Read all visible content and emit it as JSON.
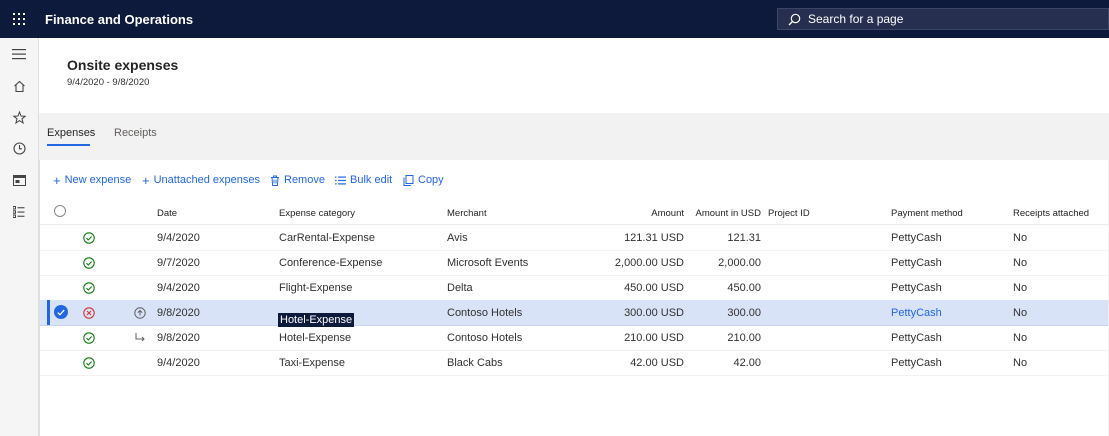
{
  "app": {
    "title": "Finance and Operations"
  },
  "search": {
    "placeholder": "Search for a page"
  },
  "nav": {
    "items": [
      "hamburger-icon",
      "home-icon",
      "star-icon",
      "clock-icon",
      "workspace-icon",
      "list-icon"
    ]
  },
  "page": {
    "title": "Onsite expenses",
    "date_range": "9/4/2020 - 9/8/2020"
  },
  "tabs": [
    {
      "label": "Expenses"
    },
    {
      "label": "Receipts"
    }
  ],
  "actions": [
    {
      "label": "New expense",
      "icon": "plus-icon"
    },
    {
      "label": "Unattached expenses",
      "icon": "plus-icon"
    },
    {
      "label": "Remove",
      "icon": "trash-icon"
    },
    {
      "label": "Bulk edit",
      "icon": "list-icon"
    },
    {
      "label": "Copy",
      "icon": "copy-icon"
    }
  ],
  "grid": {
    "columns": {
      "date": "Date",
      "category": "Expense category",
      "merchant": "Merchant",
      "amount": "Amount",
      "amount_usd": "Amount in USD",
      "project": "Project ID",
      "payment": "Payment method",
      "receipts": "Receipts attached"
    },
    "rows": [
      {
        "status": "ok",
        "sub": "",
        "date": "9/4/2020",
        "category": "CarRental-Expense",
        "merchant": "Avis",
        "amount": "121.31 USD",
        "amount_usd": "121.31",
        "project": "",
        "payment": "PettyCash",
        "receipts": "No"
      },
      {
        "status": "ok",
        "sub": "",
        "date": "9/7/2020",
        "category": "Conference-Expense",
        "merchant": "Microsoft Events",
        "amount": "2,000.00 USD",
        "amount_usd": "2,000.00",
        "project": "",
        "payment": "PettyCash",
        "receipts": "No"
      },
      {
        "status": "ok",
        "sub": "",
        "date": "9/4/2020",
        "category": "Flight-Expense",
        "merchant": "Delta",
        "amount": "450.00 USD",
        "amount_usd": "450.00",
        "project": "",
        "payment": "PettyCash",
        "receipts": "No"
      },
      {
        "status": "error",
        "sub": "itemize",
        "date": "9/8/2020",
        "category": "Hotel-Expense",
        "merchant": "Contoso Hotels",
        "amount": "300.00 USD",
        "amount_usd": "300.00",
        "project": "",
        "payment": "PettyCash",
        "receipts": "No",
        "selected": true
      },
      {
        "status": "ok",
        "sub": "child",
        "date": "9/8/2020",
        "category": "Hotel-Expense",
        "merchant": "Contoso Hotels",
        "amount": "210.00 USD",
        "amount_usd": "210.00",
        "project": "",
        "payment": "PettyCash",
        "receipts": "No"
      },
      {
        "status": "ok",
        "sub": "",
        "date": "9/4/2020",
        "category": "Taxi-Expense",
        "merchant": "Black Cabs",
        "amount": "42.00 USD",
        "amount_usd": "42.00",
        "project": "",
        "payment": "PettyCash",
        "receipts": "No"
      }
    ]
  },
  "colors": {
    "topbar": "#0e1a3b",
    "accent": "#2266e3",
    "ok": "#107c10",
    "error": "#d13438",
    "selected_row": "#d8e3f8"
  }
}
